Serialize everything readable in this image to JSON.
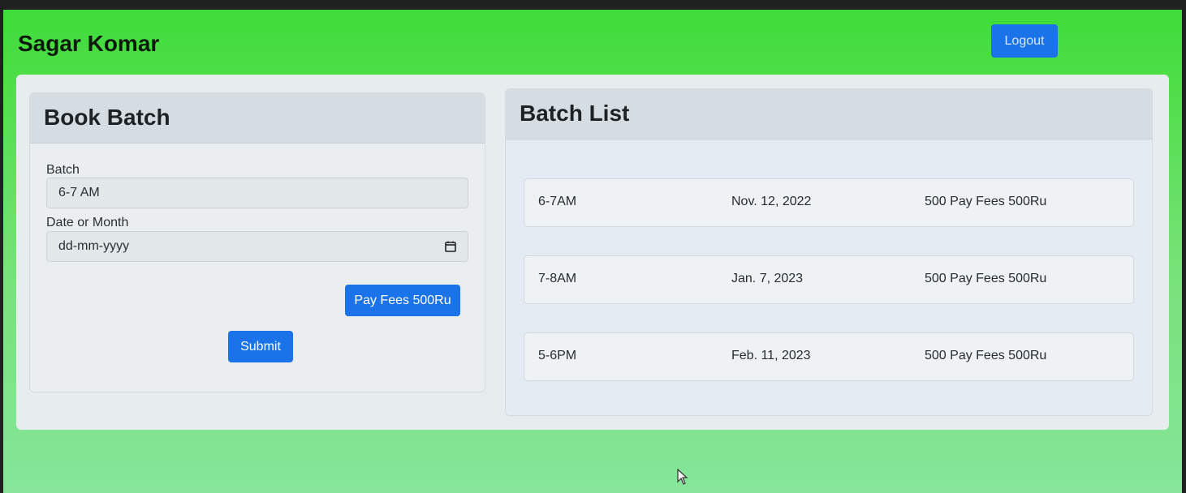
{
  "header": {
    "brand": "Sagar Komar",
    "logout_label": "Logout"
  },
  "book_batch": {
    "title": "Book Batch",
    "batch_label": "Batch",
    "batch_value": "6-7 AM",
    "date_label": "Date or Month",
    "date_placeholder": "dd-mm-yyyy",
    "pay_fees_label": "Pay Fees 500Ru",
    "submit_label": "Submit"
  },
  "batch_list": {
    "title": "Batch List",
    "rows": [
      {
        "time": "6-7AM",
        "date": "Nov. 12, 2022",
        "fees": "500 Pay Fees 500Ru"
      },
      {
        "time": "7-8AM",
        "date": "Jan. 7, 2023",
        "fees": "500 Pay Fees 500Ru"
      },
      {
        "time": "5-6PM",
        "date": "Feb. 11, 2023",
        "fees": "500 Pay Fees 500Ru"
      }
    ]
  },
  "icons": {
    "calendar": "calendar-icon",
    "cursor": "mouse-pointer-icon"
  },
  "colors": {
    "primary_button": "#1a73e8",
    "background_green": "#4fde48"
  }
}
